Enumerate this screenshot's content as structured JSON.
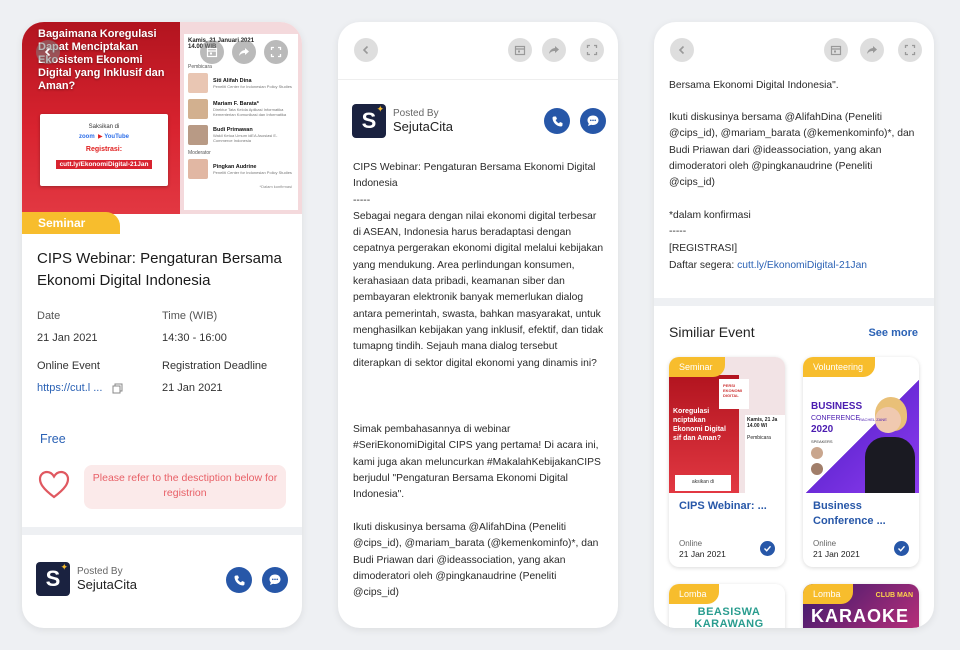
{
  "event": {
    "banner": {
      "title": "Bagaimana Koregulasi Dapat Menciptakan Ekosistem Ekonomi Digital yang Inklusif dan Aman?",
      "watch_on": "Saksikan di",
      "zoom": "zoom",
      "youtube": "YouTube",
      "register": "Registrasi:",
      "url": "cutt.ly/EkonomiDigital-21Jan",
      "date": "Kamis, 21 Januari 2021",
      "time": "14.00 WIB",
      "speakers_label": "Pembicara",
      "moderator_label": "Moderator",
      "speakers": [
        {
          "name": "Siti Alifah Dina",
          "org": "Peneliti Center for Indonesian Policy Studies"
        },
        {
          "name": "Mariam F. Barata*",
          "org": "Direktur Tata Kelola Aplikasi Informatika Kementerian Komunikasi dan Informatika"
        },
        {
          "name": "Budi Primawan",
          "org": "Wakil Ketua Umum idEA Asosiasi E-Commerce Indonesia"
        }
      ],
      "moderator": {
        "name": "Pingkan Audrine",
        "org": "Peneliti Center for Indonesian Policy Studies"
      },
      "note": "*Dalam konfirmasi"
    },
    "category": "Seminar",
    "title": "CIPS Webinar: Pengaturan Bersama Ekonomi Digital Indonesia",
    "date_label": "Date",
    "date_value": "21 Jan 2021",
    "time_label": "Time (WIB)",
    "time_value": "14:30 - 16:00",
    "location": "Online Event",
    "deadline_label": "Registration Deadline",
    "link_text": "https://cut.l ...",
    "deadline_value": "21 Jan 2021",
    "price": "Free",
    "refer_text": "Please refer to the desctiption below for registrion"
  },
  "poster": {
    "posted_by_label": "Posted By",
    "name": "SejutaCita",
    "logo_letter": "S"
  },
  "description": {
    "part1": "CIPS Webinar: Pengaturan Bersama Ekonomi Digital Indonesia\n-----\nSebagai negara dengan nilai ekonomi digital terbesar di ASEAN, Indonesia harus beradaptasi dengan cepatnya pergerakan ekonomi digital melalui kebijakan yang mendukung. Area perlindungan konsumen, kerahasiaan data pribadi, keamanan siber dan pembayaran elektronik banyak memerlukan dialog antara pemerintah, swasta, bahkan masyarakat, untuk menghasilkan kebijakan yang inklusif, efektif, dan tidak tumapng tindih. Sejauh mana dialog tersebut diterapkan di sektor digital ekonomi yang dinamis ini?",
    "part2": "Simak pembahasannya di webinar #SeriEkonomiDigital CIPS yang pertama! Di acara ini, kami juga akan meluncurkan #MakalahKebijakanCIPS berjudul \"Pengaturan Bersama Ekonomi Digital Indonesia\".",
    "part3": "Ikuti diskusinya bersama @AlifahDina (Peneliti @cips_id), @mariam_barata (@kemenkominfo)*, dan Budi Priawan dari @ideassociation, yang akan dimoderatori oleh @pingkanaudrine (Peneliti @cips_id)",
    "cont_top": "Bersama Ekonomi Digital Indonesia\".",
    "cont_part3": "Ikuti diskusinya bersama @AlifahDina (Peneliti @cips_id), @mariam_barata (@kemenkominfo)*, dan Budi Priawan dari @ideassociation, yang akan dimoderatori oleh @pingkanaudrine (Peneliti @cips_id)",
    "confirm": "*dalam konfirmasi\n-----",
    "reg_label": "[REGISTRASI]",
    "reg_prefix": "Daftar segera: ",
    "reg_link": "cutt.ly/EkonomiDigital-21Jan"
  },
  "similar": {
    "heading": "Similiar Event",
    "see_more": "See more",
    "cards": [
      {
        "tag": "Seminar",
        "title": "CIPS Webinar: ...",
        "location": "Online",
        "date": "21 Jan 2021",
        "img_text_1": "Koregulasi",
        "img_text_2": "nciptakan",
        "img_text_3": "Ekonomi Digital",
        "img_text_4": "sif dan Aman?",
        "img_date": "Kamis, 21 Ja",
        "img_time": "14.00 WI",
        "img_speakers": "Pembicara",
        "img_card": "PERSI EKONOMI DIGITAL",
        "img_foot": "aksikan di"
      },
      {
        "tag": "Volunteering",
        "title": "Business Conference ...",
        "location": "Online",
        "date": "21 Jan 2021",
        "img_line1": "BUSINESS",
        "img_line2": "CONFERENCE",
        "img_line3": "2020",
        "img_speakers": "SPEAKERS",
        "img_person": "RACHEL ZANE"
      },
      {
        "tag": "Lomba",
        "img_text": "BEASISWA KARAWANG CERDAS"
      },
      {
        "tag": "Lomba",
        "img_text": "KARAOKE",
        "img_sub": "CLUB MAN"
      }
    ]
  },
  "colors": {
    "accent": "#2757a8",
    "tag": "#f7bd2d",
    "link": "#2b62b5",
    "refer_bg": "#fbeaea",
    "refer_text": "#e86067"
  },
  "icons": [
    "chevron-left-icon",
    "calendar-icon",
    "share-icon",
    "fullscreen-icon",
    "phone-icon",
    "chat-icon",
    "heart-icon",
    "copy-icon",
    "check-icon"
  ]
}
